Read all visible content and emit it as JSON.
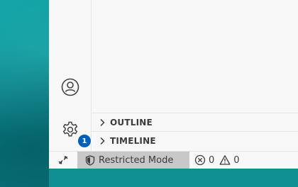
{
  "activity_bar": {
    "accounts_icon": "account-icon",
    "manage_icon": "gear-icon",
    "manage_badge": "1"
  },
  "sidebar": {
    "sections": [
      {
        "label": "OUTLINE",
        "expanded": false
      },
      {
        "label": "TIMELINE",
        "expanded": false
      }
    ]
  },
  "status_bar": {
    "remote_icon": "remote-icon",
    "restricted_label": "Restricted Mode",
    "restricted_icon": "shield-icon",
    "errors": "0",
    "warnings": "0"
  },
  "colors": {
    "badge": "#005fb8",
    "restricted_bg": "#c8c8c8",
    "desktop": "#0f8f92"
  }
}
